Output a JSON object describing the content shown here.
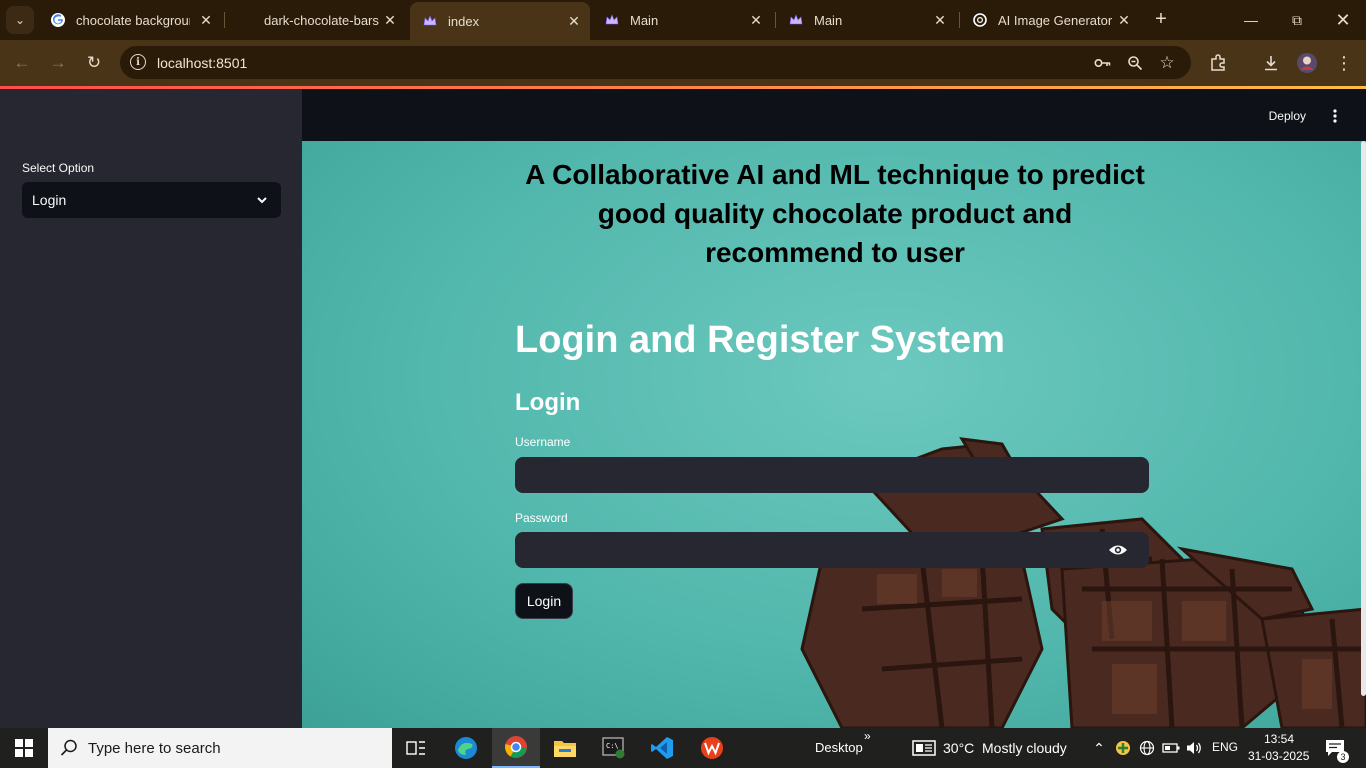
{
  "browser": {
    "tabs": [
      {
        "title": "chocolate backgrounc",
        "favicon": "google-g-icon"
      },
      {
        "title": "dark-chocolate-bars.j",
        "favicon": "image-file-icon"
      },
      {
        "title": "index",
        "favicon": "streamlit-crown-icon",
        "active": true
      },
      {
        "title": "Main",
        "favicon": "streamlit-crown-icon"
      },
      {
        "title": "Main",
        "favicon": "streamlit-crown-icon"
      },
      {
        "title": "AI Image Generator",
        "favicon": "openai-icon"
      }
    ],
    "url": "localhost:8501"
  },
  "sidebar": {
    "select_label": "Select Option",
    "select_value": "Login"
  },
  "header": {
    "deploy_label": "Deploy"
  },
  "main": {
    "title": "A Collaborative AI and ML technique to predict good quality chocolate product and recommend to user",
    "system_title": "Login and Register System",
    "section_title": "Login",
    "username_label": "Username",
    "username_value": "",
    "password_label": "Password",
    "password_value": "",
    "login_button": "Login"
  },
  "taskbar": {
    "search_placeholder": "Type here to search",
    "desktop_label": "Desktop",
    "weather_temp": "30°C",
    "weather_text": "Mostly cloudy",
    "language": "ENG",
    "time": "13:54",
    "date": "31-03-2025",
    "notification_count": "3"
  },
  "colors": {
    "accent_gradient_start": "#ff4b4b",
    "accent_gradient_end": "#ffbd45",
    "sidebar_bg": "#262730",
    "header_bg": "#0e1117",
    "background_teal": "#5fbdb3"
  }
}
